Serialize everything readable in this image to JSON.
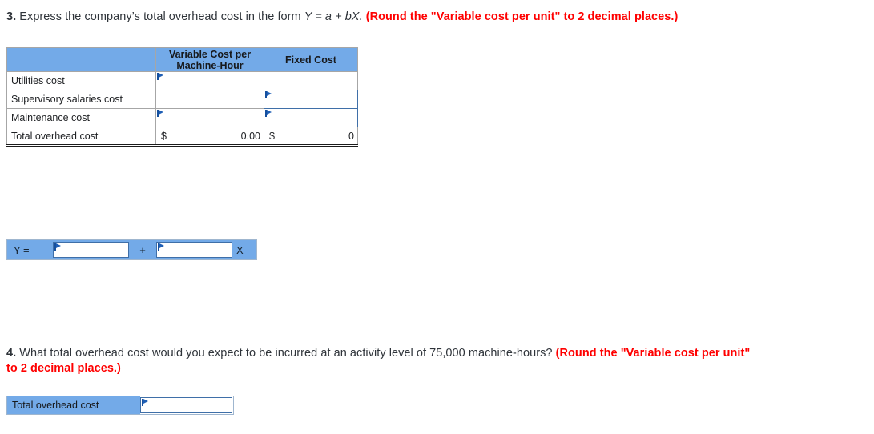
{
  "question3": {
    "number": "3.",
    "text_before": "Express the company’s total overhead cost in the form",
    "formula": "Y = a + bX.",
    "instruction": "(Round the \"Variable cost per unit\" to 2 decimal places.)"
  },
  "cost_table": {
    "headers": {
      "row_label": "",
      "variable": "Variable Cost per Machine-Hour",
      "variable_line1": "Variable Cost per",
      "variable_line2": "Machine-Hour",
      "fixed": "Fixed Cost"
    },
    "rows": [
      {
        "label": "Utilities cost",
        "variable_value": "",
        "variable_entry": true,
        "fixed_value": "",
        "fixed_entry": false
      },
      {
        "label": "Supervisory salaries cost",
        "variable_value": "",
        "variable_entry": false,
        "fixed_value": "",
        "fixed_entry": true
      },
      {
        "label": "Maintenance cost",
        "variable_value": "",
        "variable_entry": true,
        "fixed_value": "",
        "fixed_entry": true
      }
    ],
    "total": {
      "label": "Total overhead cost",
      "variable_currency": "$",
      "variable_value": "0.00",
      "fixed_currency": "$",
      "fixed_value": "0"
    }
  },
  "equation": {
    "lead_label": "Y =",
    "operator_label": "+",
    "variable_label": "X",
    "intercept_value": "",
    "slope_value": ""
  },
  "question4": {
    "number": "4.",
    "text": "What total overhead cost would you expect to be incurred at an activity level of 75,000 machine-hours?",
    "instruction": "(Round the \"Variable cost per unit\" to 2 decimal places.)"
  },
  "answer_table": {
    "label": "Total overhead cost",
    "value": ""
  },
  "colors": {
    "header_blue": "#73AAE8",
    "entry_border_blue": "#3f6fa8",
    "flag_blue": "#1f5fb5",
    "instruction_red": "#ff0000",
    "body_text": "#2f343a"
  }
}
